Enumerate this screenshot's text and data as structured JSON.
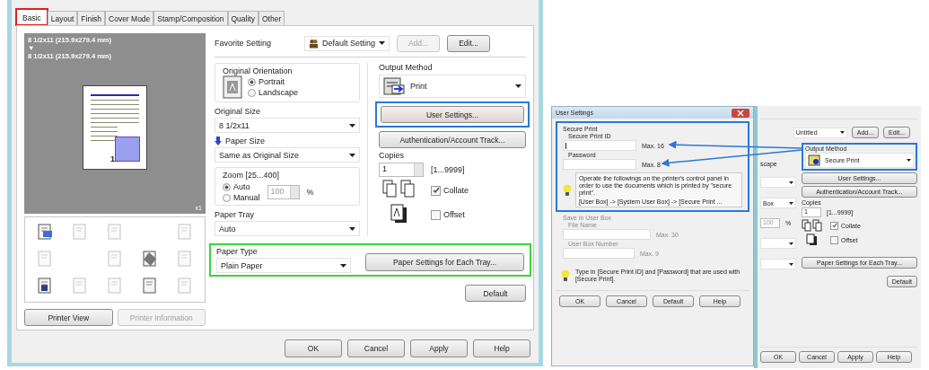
{
  "main_dialog": {
    "tabs": [
      {
        "label": "Basic",
        "selected": true
      },
      {
        "label": "Layout",
        "selected": false
      },
      {
        "label": "Finish",
        "selected": false
      },
      {
        "label": "Cover Mode",
        "selected": false
      },
      {
        "label": "Stamp/Composition",
        "selected": false
      },
      {
        "label": "Quality",
        "selected": false
      },
      {
        "label": "Other",
        "selected": false
      }
    ],
    "preview": {
      "lines": [
        "8 1/2x11 (215.9x279.4 mm)",
        "▼",
        "8 1/2x11 (215.9x279.4 mm)"
      ],
      "page_number": "1",
      "count": "x1"
    },
    "left_buttons": [
      {
        "label": "Printer View",
        "disabled": false
      },
      {
        "label": "Printer Information",
        "disabled": true
      }
    ],
    "favorite_setting": {
      "label": "Favorite Setting",
      "value": "Default Setting",
      "add": {
        "label": "Add...",
        "disabled": true
      },
      "edit": {
        "label": "Edit...",
        "disabled": false
      }
    },
    "original_orientation": {
      "label": "Original Orientation",
      "options": [
        {
          "label": "Portrait",
          "selected": true
        },
        {
          "label": "Landscape",
          "selected": false
        }
      ]
    },
    "original_size": {
      "label": "Original Size",
      "value": "8 1/2x11"
    },
    "paper_size": {
      "label": "Paper Size",
      "value": "Same as Original Size"
    },
    "zoom": {
      "label": "Zoom [25...400]",
      "options": [
        {
          "label": "Auto",
          "selected": true
        },
        {
          "label": "Manual",
          "selected": false
        }
      ],
      "value": "100",
      "unit": "%"
    },
    "paper_tray": {
      "label": "Paper Tray",
      "value": "Auto"
    },
    "paper_type": {
      "label": "Paper Type",
      "value": "Plain Paper"
    },
    "output_method": {
      "label": "Output Method",
      "value": "Print"
    },
    "user_settings_button": "User Settings...",
    "auth_button": "Authentication/Account Track...",
    "copies": {
      "label": "Copies",
      "value": "1",
      "range": "[1...9999]"
    },
    "collate": {
      "label": "Collate",
      "checked": true
    },
    "offset": {
      "label": "Offset",
      "checked": false
    },
    "paper_settings_button": "Paper Settings for Each Tray...",
    "default_button": "Default",
    "buttons": [
      "OK",
      "Cancel",
      "Apply",
      "Help"
    ]
  },
  "user_settings_dialog": {
    "title": "User Settings",
    "secure_print": {
      "label": "Secure Print",
      "id_label": "Secure Print ID",
      "id_hint": "Max. 16",
      "password_label": "Password",
      "password_hint": "Max. 8",
      "info": "Operate the followings on the printer's control panel in order to use the documents which is printed by \"secure print\".",
      "path": "[User Box] -> [System User Box] -> [Secure Print ..."
    },
    "save_in_user_box": {
      "label": "Save in User Box",
      "disabled": true,
      "file_name_label": "File Name",
      "file_name_hint": "Max. 30",
      "box_number_label": "User Box Number",
      "box_number_hint": "Max. 9"
    },
    "tip": "Type in [Secure Print ID] and [Password] that are used with [Secure Print].",
    "buttons": [
      "OK",
      "Cancel",
      "Default",
      "Help"
    ]
  },
  "background_dialog": {
    "favorite_value": "Untitled",
    "add": "Add...",
    "edit": "Edit...",
    "fragments": [
      "scape",
      "Box"
    ],
    "zoom_value": "100",
    "zoom_unit": "%",
    "output_method": {
      "label": "Output Method",
      "value": "Secure Print"
    },
    "user_settings_button": "User Settings...",
    "auth_button": "Authentication/Account Track...",
    "copies": {
      "label": "Copies",
      "value": "1",
      "range": "[1...9999]"
    },
    "collate": {
      "label": "Collate",
      "checked": true
    },
    "offset": {
      "label": "Offset",
      "checked": false
    },
    "paper_settings_button": "Paper Settings for Each Tray...",
    "default_button": "Default",
    "buttons": [
      "OK",
      "Cancel",
      "Apply",
      "Help"
    ]
  }
}
